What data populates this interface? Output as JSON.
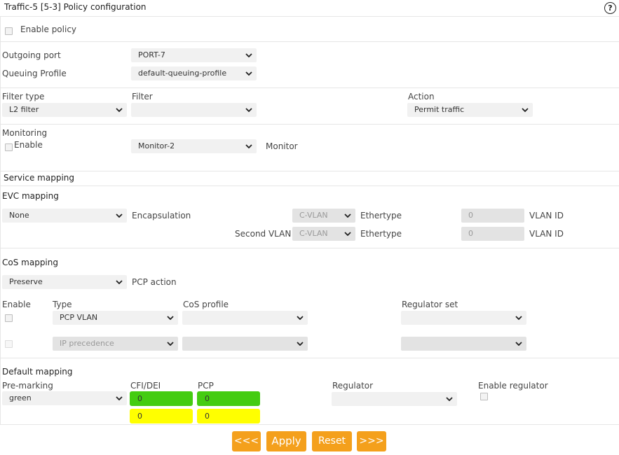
{
  "header": {
    "title": "Traffic-5 [5-3] Policy configuration",
    "help_icon": "?"
  },
  "policy": {
    "enable_label": "Enable policy"
  },
  "port": {
    "outgoing_label": "Outgoing port",
    "outgoing_value": "PORT-7",
    "queuing_label": "Queuing Profile",
    "queuing_value": "default-queuing-profile"
  },
  "filter": {
    "type_label": "Filter type",
    "type_value": "L2 filter",
    "filter_label": "Filter",
    "filter_value": "",
    "action_label": "Action",
    "action_value": "Permit traffic"
  },
  "monitoring": {
    "title": "Monitoring",
    "enable_label": "Enable",
    "monitor_value": "Monitor-2",
    "monitor_label": "Monitor"
  },
  "service_mapping": {
    "title": "Service mapping"
  },
  "evc": {
    "title": "EVC mapping",
    "mapping_value": "None",
    "encapsulation_label": "Encapsulation",
    "row1": {
      "encap_value": "C-VLAN",
      "ethertype_label": "Ethertype",
      "vlan_value": "0",
      "vlan_label": "VLAN ID"
    },
    "second_vlan_label": "Second VLAN",
    "row2": {
      "encap_value": "C-VLAN",
      "ethertype_label": "Ethertype",
      "vlan_value": "0",
      "vlan_label": "VLAN ID"
    }
  },
  "cos": {
    "title": "CoS mapping",
    "pcp_action_value": "Preserve",
    "pcp_action_label": "PCP action",
    "headers": {
      "enable": "Enable",
      "type": "Type",
      "cos_profile": "CoS profile",
      "regulator_set": "Regulator set"
    },
    "rows": [
      {
        "type": "PCP VLAN",
        "cos_profile": "",
        "regulator_set": ""
      },
      {
        "type": "IP precedence",
        "cos_profile": "",
        "regulator_set": ""
      }
    ]
  },
  "default_mapping": {
    "title": "Default mapping",
    "premarking_label": "Pre-marking",
    "premarking_value": "green",
    "cfi_label": "CFI/DEI",
    "pcp_label": "PCP",
    "green_cfi": "0",
    "green_pcp": "0",
    "yellow_cfi": "0",
    "yellow_pcp": "0",
    "regulator_label": "Regulator",
    "regulator_value": "",
    "enable_regulator_label": "Enable regulator"
  },
  "buttons": {
    "prev": "<<<",
    "apply": "Apply",
    "reset": "Reset",
    "next": ">>>"
  },
  "colors": {
    "accent": "#f4a01c",
    "green": "#44cc11",
    "yellow": "#ffff00"
  }
}
